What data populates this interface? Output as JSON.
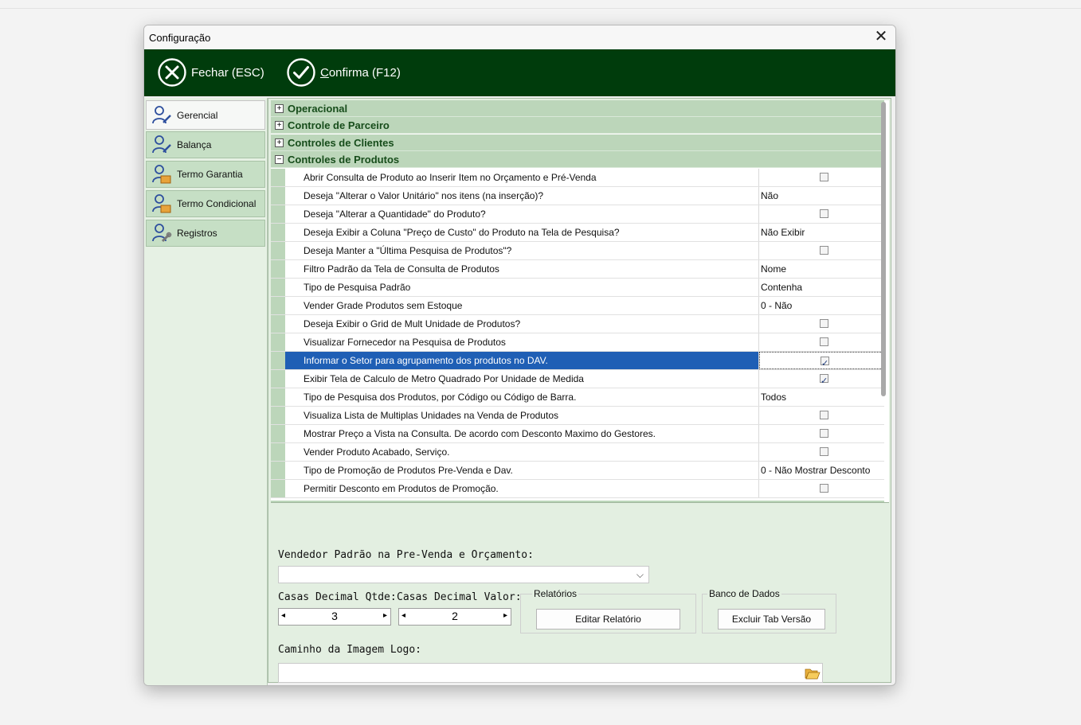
{
  "window": {
    "title": "Configuração",
    "close_glyph": "✕"
  },
  "toolbar": {
    "close_label": "Fechar (ESC)",
    "confirm_hotkey": "C",
    "confirm_rest": "onfirma (F12)"
  },
  "sidebar": {
    "items": [
      {
        "label": "Gerencial",
        "icon": "user-edit-icon"
      },
      {
        "label": "Balança",
        "icon": "user-edit-icon"
      },
      {
        "label": "Termo Garantia",
        "icon": "user-shield-icon"
      },
      {
        "label": "Termo Condicional",
        "icon": "user-shield-icon"
      },
      {
        "label": "Registros",
        "icon": "user-wrench-icon"
      }
    ]
  },
  "grid": {
    "categories": [
      {
        "label": "Operacional",
        "expander": "+"
      },
      {
        "label": "Controle de Parceiro",
        "expander": "+"
      },
      {
        "label": "Controles de Clientes",
        "expander": "+"
      },
      {
        "label": "Controles de Produtos",
        "expander": "−"
      }
    ],
    "rows": [
      {
        "name": "Abrir Consulta de Produto ao Inserir Item no Orçamento e Pré-Venda",
        "type": "check",
        "checked": false
      },
      {
        "name": "Deseja \"Alterar o Valor Unitário\" nos itens (na inserção)?",
        "type": "text",
        "value": "Não"
      },
      {
        "name": "Deseja \"Alterar a Quantidade\" do Produto?",
        "type": "check",
        "checked": false
      },
      {
        "name": "Deseja Exibir a Coluna \"Preço de Custo\" do Produto na Tela de Pesquisa?",
        "type": "text",
        "value": "Não Exibir"
      },
      {
        "name": "Deseja Manter a \"Última Pesquisa de Produtos\"?",
        "type": "check",
        "checked": false
      },
      {
        "name": "Filtro Padrão da Tela de Consulta de Produtos",
        "type": "text",
        "value": "Nome"
      },
      {
        "name": "Tipo de Pesquisa Padrão",
        "type": "text",
        "value": "Contenha"
      },
      {
        "name": "Vender Grade Produtos sem Estoque",
        "type": "text",
        "value": "0 - Não"
      },
      {
        "name": "Deseja Exibir o Grid de Mult Unidade de Produtos?",
        "type": "check",
        "checked": false
      },
      {
        "name": "Visualizar Fornecedor na Pesquisa de Produtos",
        "type": "check",
        "checked": false
      },
      {
        "name": "Informar o Setor para agrupamento dos produtos no DAV.",
        "type": "check",
        "checked": true,
        "selected": true
      },
      {
        "name": "Exibir Tela de Calculo de Metro Quadrado Por Unidade de Medida",
        "type": "check",
        "checked": true
      },
      {
        "name": "Tipo de Pesquisa dos Produtos, por Código ou Código de Barra.",
        "type": "text",
        "value": "Todos"
      },
      {
        "name": "Visualiza Lista de Multiplas Unidades na Venda de Produtos",
        "type": "check",
        "checked": false
      },
      {
        "name": "Mostrar Preço a Vista na Consulta. De acordo com Desconto Maximo do Gestores.",
        "type": "check",
        "checked": false
      },
      {
        "name": "Vender Produto Acabado, Serviço.",
        "type": "check",
        "checked": false
      },
      {
        "name": "Tipo de Promoção de Produtos Pre-Venda e Dav.",
        "type": "text",
        "value": "0 - Não Mostrar Desconto"
      },
      {
        "name": "Permitir Desconto em Produtos de Promoção.",
        "type": "check",
        "checked": false
      }
    ]
  },
  "form": {
    "seller_label": "Vendedor Padrão na Pre-Venda e Orçamento:",
    "seller_value": "",
    "qty_dec_label": "Casas Decimal Qtde:",
    "qty_dec_value": "3",
    "val_dec_label": "Casas Decimal Valor:",
    "val_dec_value": "2",
    "spin_left": "◂",
    "spin_right": "▸",
    "reports_caption": "Relatórios",
    "edit_report_label": "Editar Relatório",
    "db_caption": "Banco de Dados",
    "delete_tab_label": "Excluir Tab Versão",
    "logo_path_label": "Caminho da Imagem Logo:",
    "logo_path_value": ""
  },
  "colors": {
    "toolbar_bg": "#003c0c",
    "category_bg": "#bcd6ba",
    "selection": "#1f5fb5",
    "panel_bg": "#e3efe1"
  }
}
